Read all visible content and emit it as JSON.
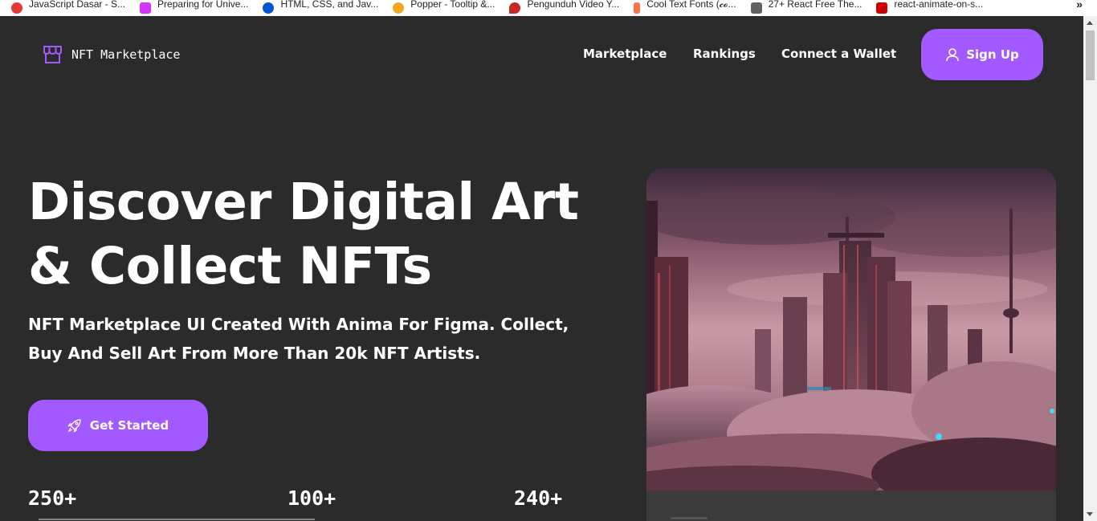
{
  "bookmarks": [
    {
      "label": "JavaScript Dasar - S...",
      "icon": "js-bookmark-icon",
      "color": "#e53935"
    },
    {
      "label": "Preparing for Unive...",
      "icon": "figma-bookmark-icon",
      "color": "#d633ff"
    },
    {
      "label": "HTML, CSS, and Jav...",
      "icon": "coursera-bookmark-icon",
      "color": "#0056d2"
    },
    {
      "label": "Popper - Tooltip &...",
      "icon": "popper-bookmark-icon",
      "color": "#f5a623"
    },
    {
      "label": "Pengunduh Video Y...",
      "icon": "video-bookmark-icon",
      "color": "#c62828"
    },
    {
      "label": "Cool Text Fonts (𝓬𝓸...",
      "icon": "font-bookmark-icon",
      "color": "#ff7043"
    },
    {
      "label": "27+ React Free The...",
      "icon": "react-bookmark-icon",
      "color": "#616161"
    },
    {
      "label": "react-animate-on-s...",
      "icon": "npm-bookmark-icon",
      "color": "#cb0000"
    }
  ],
  "bookmarks_more": "»",
  "header": {
    "logo_text": "NFT Marketplace",
    "logo_icon": "storefront-icon",
    "nav": [
      "Marketplace",
      "Rankings",
      "Connect a Wallet"
    ],
    "signup_label": "Sign Up",
    "signup_icon": "user-icon"
  },
  "hero": {
    "title_line1": "Discover Digital Art",
    "title_line2": "& Collect NFTs",
    "subtitle_line1": "NFT Marketplace UI Created With Anima For Figma. Collect,",
    "subtitle_line2": "Buy And Sell Art From More Than 20k NFT Artists.",
    "cta_label": "Get Started",
    "cta_icon": "rocket-icon",
    "stats": [
      "250+",
      "100+",
      "240+"
    ],
    "image": "futuristic-city-in-clouds-artwork"
  },
  "colors": {
    "background": "#2b2b2b",
    "accent": "#a259ff",
    "card": "#3b3b3b",
    "text": "#ffffff"
  }
}
